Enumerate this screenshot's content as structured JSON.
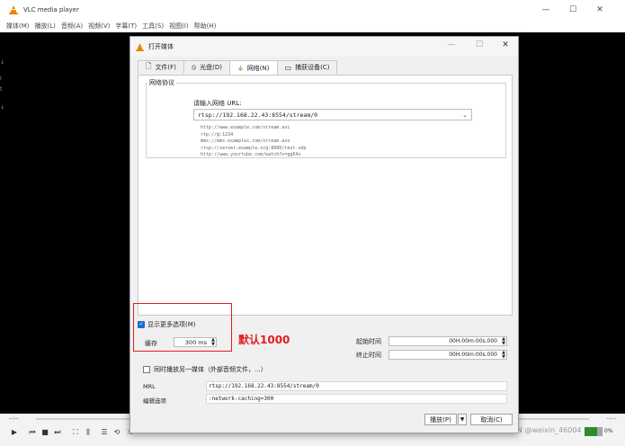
{
  "app": {
    "title": "VLC media player",
    "menus": [
      "媒体(M)",
      "播放(L)",
      "音频(A)",
      "视频(V)",
      "字幕(T)",
      "工具(S)",
      "视图(I)",
      "帮助(H)"
    ],
    "time_left": "--:--",
    "time_right": "--:--",
    "volume": "0%",
    "watermark": "CSDN @weixin_46004"
  },
  "dialog": {
    "title": "打开媒体",
    "tabs": [
      {
        "label": "文件(F)",
        "icon": "file-icon"
      },
      {
        "label": "光盘(D)",
        "icon": "disc-icon"
      },
      {
        "label": "网络(N)",
        "icon": "network-icon",
        "active": true
      },
      {
        "label": "捕获设备(C)",
        "icon": "capture-device-icon"
      }
    ],
    "group_label": "网络协议",
    "url_prompt": "请输入网络 URL:",
    "url_value": "rtsp://192.168.22.43:8554/stream/0",
    "examples": [
      "http://www.example.com/stream.avi",
      "rtp://@:1234",
      "mms://mms.examples.com/stream.asx",
      "rtsp://server.example.org:8080/test.sdp",
      "http://www.yourtube.com/watch?v=gg64x"
    ],
    "show_more_label": "显示更多选项(M)",
    "show_more_checked": true,
    "cache_label": "缓存",
    "cache_value": "300 ms",
    "annotation": "默认1000",
    "start_time_label": "起始时间",
    "start_time_value": "00H:00m:00s.000",
    "stop_time_label": "终止时间",
    "stop_time_value": "00H:00m:00s.000",
    "sync_label": "同时播放另一媒体（外部音频文件，...）",
    "mrl_label": "MRL",
    "mrl_value": "rtsp://192.168.22.43:8554/stream/0",
    "edit_options_label": "编辑选项",
    "edit_options_value": ":network-caching=300",
    "play_button": "播放(P)",
    "cancel_button": "取消(C)"
  }
}
